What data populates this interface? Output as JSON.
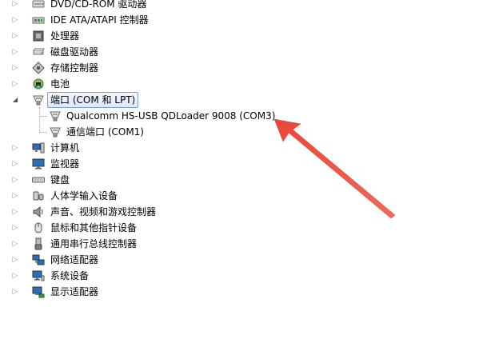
{
  "device_tree": {
    "items": [
      {
        "label": "DVD/CD-ROM 驱动器",
        "icon": "dvd-drive-icon",
        "expanded": false
      },
      {
        "label": "IDE ATA/ATAPI 控制器",
        "icon": "ide-controller-icon",
        "expanded": false
      },
      {
        "label": "处理器",
        "icon": "processor-icon",
        "expanded": false
      },
      {
        "label": "磁盘驱动器",
        "icon": "disk-drive-icon",
        "expanded": false
      },
      {
        "label": "存储控制器",
        "icon": "storage-controller-icon",
        "expanded": false
      },
      {
        "label": "电池",
        "icon": "battery-icon",
        "expanded": false
      },
      {
        "label": "端口 (COM 和 LPT)",
        "icon": "port-icon",
        "expanded": true,
        "selected": true,
        "children": [
          {
            "label": "Qualcomm HS-USB QDLoader 9008 (COM3)",
            "icon": "port-icon"
          },
          {
            "label": "通信端口 (COM1)",
            "icon": "port-icon"
          }
        ]
      },
      {
        "label": "计算机",
        "icon": "computer-icon",
        "expanded": false
      },
      {
        "label": "监视器",
        "icon": "monitor-icon",
        "expanded": false
      },
      {
        "label": "键盘",
        "icon": "keyboard-icon",
        "expanded": false
      },
      {
        "label": "人体学输入设备",
        "icon": "hid-icon",
        "expanded": false
      },
      {
        "label": "声音、视频和游戏控制器",
        "icon": "speaker-icon",
        "expanded": false
      },
      {
        "label": "鼠标和其他指针设备",
        "icon": "mouse-icon",
        "expanded": false
      },
      {
        "label": "通用串行总线控制器",
        "icon": "usb-icon",
        "expanded": false
      },
      {
        "label": "网络适配器",
        "icon": "network-adapter-icon",
        "expanded": false
      },
      {
        "label": "系统设备",
        "icon": "system-device-icon",
        "expanded": false
      },
      {
        "label": "显示适配器",
        "icon": "display-adapter-icon",
        "expanded": false
      }
    ]
  },
  "colors": {
    "selection_border": "#7da2ce",
    "selection_fill": "#dce9f9",
    "annotation_arrow": "#e8473a"
  }
}
